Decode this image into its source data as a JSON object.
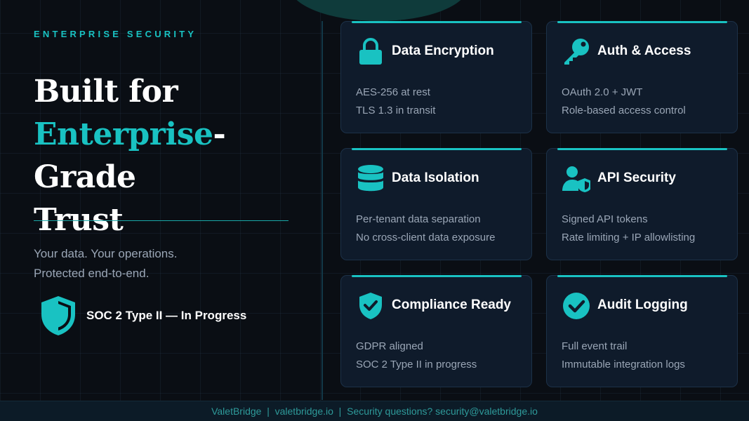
{
  "eyebrow": "ENTERPRISE SECURITY",
  "headline": {
    "line1": "Built for",
    "accent": "Enterprise",
    "line2_rest": "-Grade",
    "line3": "Trust"
  },
  "tagline": {
    "line1": "Your data. Your operations.",
    "line2": "Protected end-to-end."
  },
  "soc_badge": {
    "icon": "shield-icon",
    "label": "SOC 2 Type II — In Progress"
  },
  "cards": [
    {
      "icon": "lock-icon",
      "title": "Data Encryption",
      "lines": [
        "AES-256 at rest",
        "TLS 1.3 in transit"
      ]
    },
    {
      "icon": "key-icon",
      "title": "Auth & Access",
      "lines": [
        "OAuth 2.0 + JWT",
        "Role-based access control"
      ]
    },
    {
      "icon": "database-icon",
      "title": "Data Isolation",
      "lines": [
        "Per-tenant data separation",
        "No cross-client data exposure"
      ]
    },
    {
      "icon": "user-shield-icon",
      "title": "API Security",
      "lines": [
        "Signed API tokens",
        "Rate limiting + IP allowlisting"
      ]
    },
    {
      "icon": "shield-check-icon",
      "title": "Compliance Ready",
      "lines": [
        "GDPR aligned",
        "SOC 2 Type II in progress"
      ]
    },
    {
      "icon": "check-circle-icon",
      "title": "Audit Logging",
      "lines": [
        "Full event trail",
        "Immutable integration logs"
      ]
    }
  ],
  "footer": {
    "text": "ValetBridge  |  valetbridge.io  |  Security questions? security@valetbridge.io"
  },
  "colors": {
    "accent": "#19c2c2",
    "background": "#0a0e14",
    "card": "#0f1b2b",
    "muted_text": "#9aa6b6"
  }
}
